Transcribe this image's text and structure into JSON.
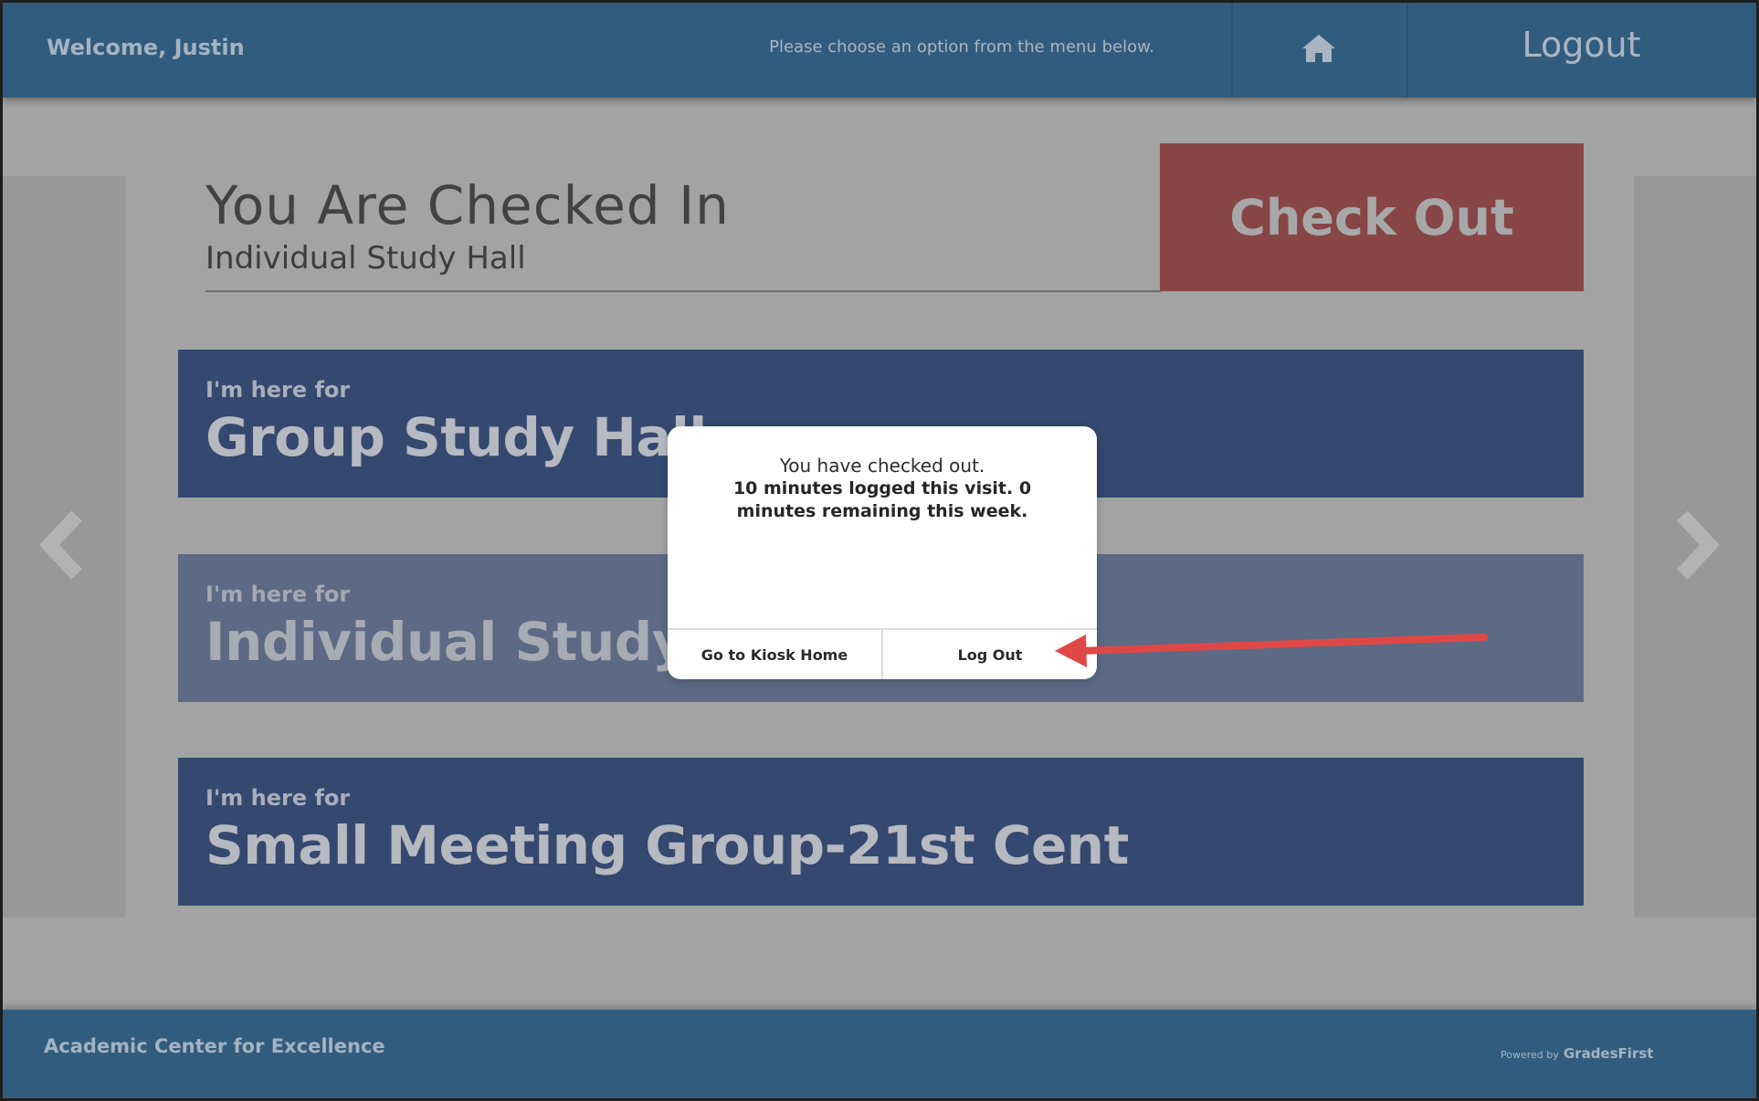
{
  "header": {
    "welcome": "Welcome, Justin",
    "instruction": "Please choose an option from the menu below.",
    "home_icon": "home-icon",
    "logout_label": "Logout"
  },
  "status": {
    "title": "You Are Checked In",
    "location": "Individual Study Hall",
    "checkout_label": "Check Out"
  },
  "options": [
    {
      "prefix": "I'm here for",
      "name": "Group Study Hall"
    },
    {
      "prefix": "I'm here for",
      "name": "Individual Study Hall"
    },
    {
      "prefix": "I'm here for",
      "name": "Small Meeting Group-21st Cent"
    }
  ],
  "nav": {
    "prev_icon": "chevron-left-icon",
    "next_icon": "chevron-right-icon"
  },
  "footer": {
    "org_name": "Academic Center for Excellence",
    "powered_prefix": "Powered by",
    "powered_brand": "GradesFirst"
  },
  "modal": {
    "message": "You have checked out.",
    "detail": "10 minutes logged this visit. 0 minutes remaining this week.",
    "kiosk_home_label": "Go to Kiosk Home",
    "logout_label": "Log Out"
  },
  "colors": {
    "header_bg": "#325c7e",
    "card_bg": "#344870",
    "checkout_bg": "#874546",
    "overlay_bg": "#a3a3a3",
    "annotation_arrow": "#e04848"
  }
}
